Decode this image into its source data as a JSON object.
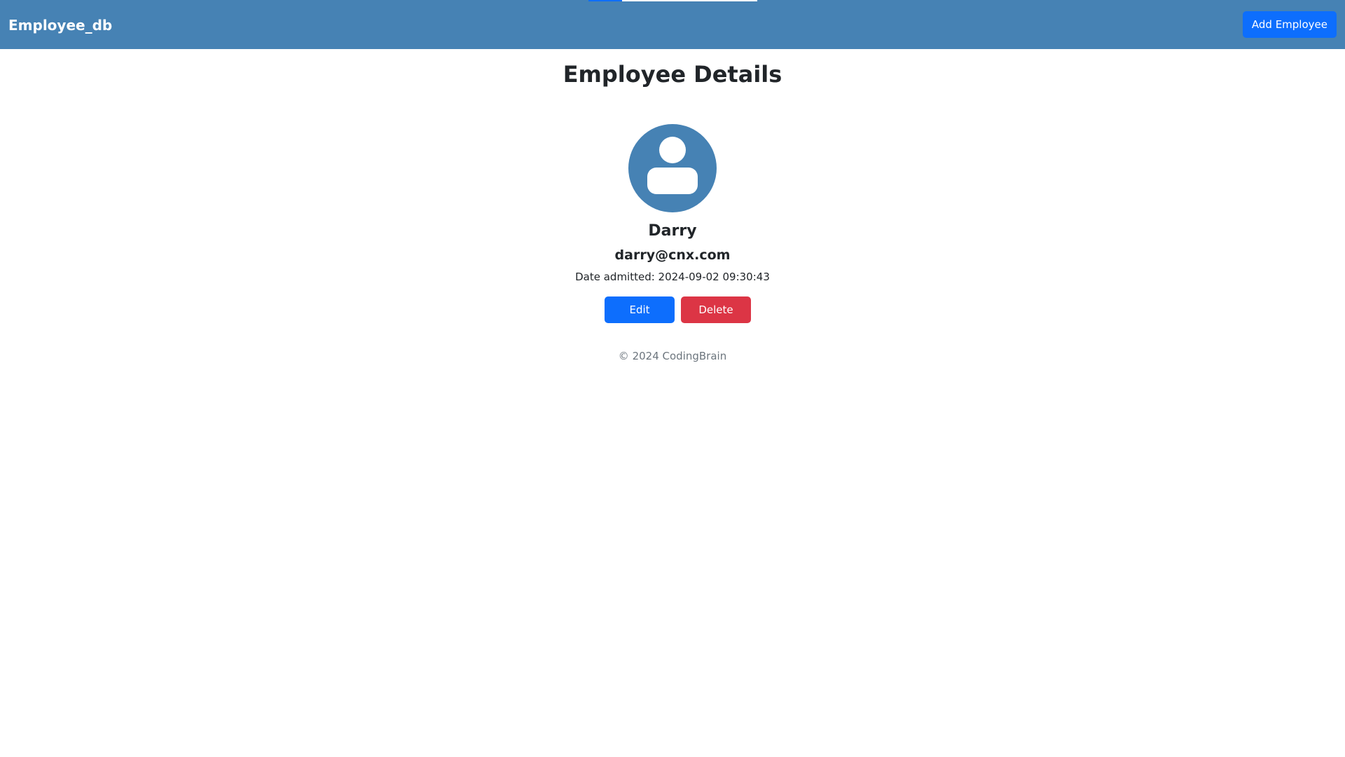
{
  "navbar": {
    "brand": "Employee_db",
    "add_button_label": "Add Employee"
  },
  "page": {
    "title": "Employee Details"
  },
  "employee": {
    "avatar_icon": "user-avatar-icon",
    "name": "Darry",
    "email": "darry@cnx.com",
    "date_admitted": "Date admitted: 2024-09-02 09:30:43"
  },
  "actions": {
    "edit_label": "Edit",
    "delete_label": "Delete"
  },
  "footer": {
    "text": "© 2024 CodingBrain"
  },
  "colors": {
    "navbar_bg": "#4682b4",
    "primary": "#0d6efd",
    "danger": "#dc3545",
    "avatar_bg": "#4682b4",
    "footer_text": "#6c757d"
  }
}
